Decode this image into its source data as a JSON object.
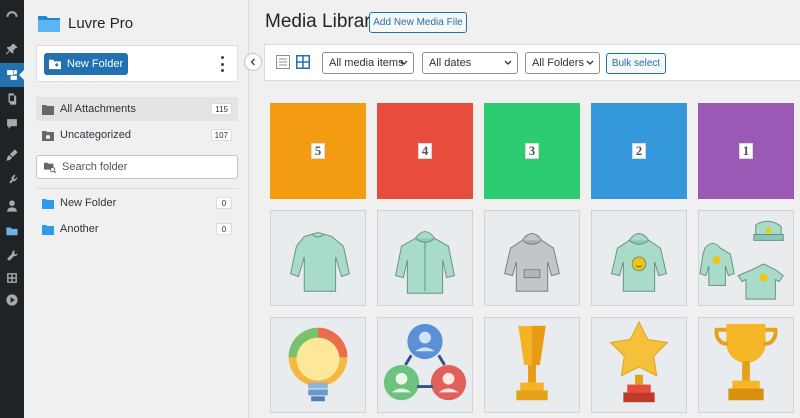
{
  "sidebar": {
    "brand": "Luvre Pro",
    "new_folder_button": "New Folder",
    "search_placeholder": "Search folder",
    "system_folders": [
      {
        "label": "All Attachments",
        "count": "115",
        "active": true
      },
      {
        "label": "Uncategorized",
        "count": "107",
        "active": false
      }
    ],
    "folders": [
      {
        "label": "New Folder",
        "count": "0"
      },
      {
        "label": "Another",
        "count": "0"
      }
    ]
  },
  "header": {
    "title": "Media Library",
    "add_new_label": "Add New Media File"
  },
  "toolbar": {
    "filter_type": "All media items",
    "filter_date": "All dates",
    "filter_folder": "All Folders",
    "bulk_select_label": "Bulk select"
  },
  "media": {
    "row1": [
      {
        "label": "5",
        "color": "#f39c12"
      },
      {
        "label": "4",
        "color": "#e74c3c"
      },
      {
        "label": "3",
        "color": "#2ecc71"
      },
      {
        "label": "2",
        "color": "#3498db"
      },
      {
        "label": "1",
        "color": "#9b59b6"
      }
    ],
    "row2_icons": [
      "sweatshirt-icon",
      "zip-hoodie-icon",
      "gray-hoodie-icon",
      "smiley-hoodie-icon",
      "merch-set-icon"
    ],
    "row3_icons": [
      "lightbulb-icon",
      "team-network-icon",
      "trophy-icon",
      "star-trophy-icon",
      "cup-trophy-icon"
    ]
  },
  "colors": {
    "accent": "#2271b1",
    "admin_bar": "#1d2327",
    "tile_bg": "#e9ecef"
  }
}
